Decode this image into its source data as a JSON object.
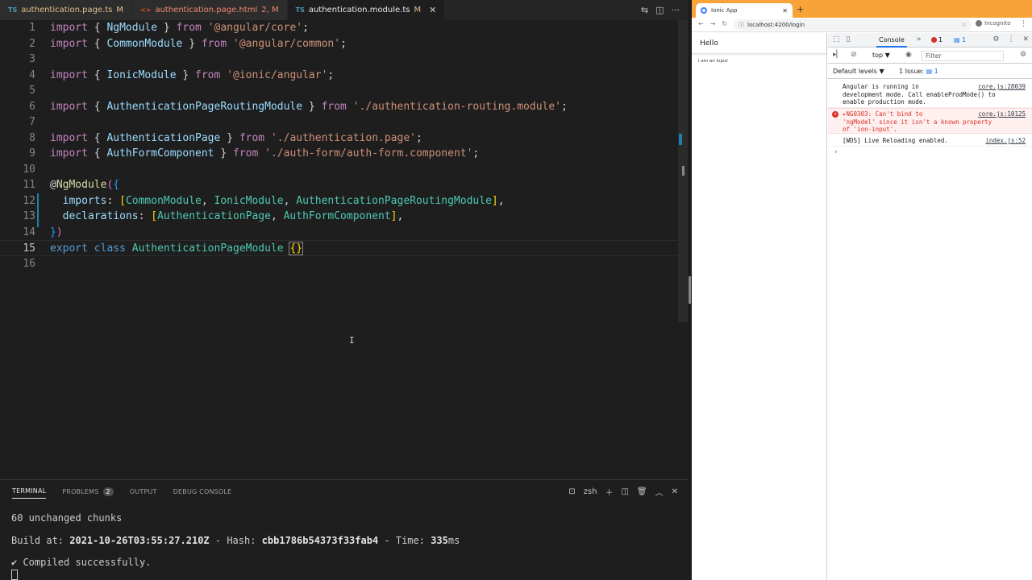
{
  "editor": {
    "tabs": [
      {
        "lang": "TS",
        "name": "authentication.page.ts",
        "status": "M"
      },
      {
        "lang": "",
        "name": "authentication.page.html",
        "status": "2, M"
      },
      {
        "lang": "TS",
        "name": "authentication.module.ts",
        "status": "M"
      }
    ],
    "lines": [
      {
        "n": "1"
      },
      {
        "n": "2"
      },
      {
        "n": "3"
      },
      {
        "n": "4"
      },
      {
        "n": "5"
      },
      {
        "n": "6"
      },
      {
        "n": "7"
      },
      {
        "n": "8"
      },
      {
        "n": "9"
      },
      {
        "n": "10"
      },
      {
        "n": "11"
      },
      {
        "n": "12"
      },
      {
        "n": "13"
      },
      {
        "n": "14"
      },
      {
        "n": "15"
      },
      {
        "n": "16"
      }
    ],
    "code": {
      "l1": {
        "kw": "import",
        "o": "{",
        "id": "NgModule",
        "c": "}",
        "from": "from",
        "str": "'@angular/core'",
        "end": ";"
      },
      "l2": {
        "kw": "import",
        "o": "{",
        "id": "CommonModule",
        "c": "}",
        "from": "from",
        "str": "'@angular/common'",
        "end": ";"
      },
      "l4": {
        "kw": "import",
        "o": "{",
        "id": "IonicModule",
        "c": "}",
        "from": "from",
        "str": "'@ionic/angular'",
        "end": ";"
      },
      "l6": {
        "kw": "import",
        "o": "{",
        "id": "AuthenticationPageRoutingModule",
        "c": "}",
        "from": "from",
        "str": "'./authentication-routing.module'",
        "end": ";"
      },
      "l8": {
        "kw": "import",
        "o": "{",
        "id": "AuthenticationPage",
        "c": "}",
        "from": "from",
        "str": "'./authentication.page'",
        "end": ";"
      },
      "l9": {
        "kw": "import",
        "o": "{",
        "id": "AuthFormComponent",
        "c": "}",
        "from": "from",
        "str": "'./auth-form/auth-form.component'",
        "end": ";"
      },
      "l11": {
        "at": "@",
        "fn": "NgModule",
        "o": "(",
        "b": "{"
      },
      "l12": {
        "prop": "imports",
        "colon": ":",
        "o": "[",
        "a": "CommonModule",
        "b": "IonicModule",
        "c": "AuthenticationPageRoutingModule",
        "cl": "]",
        "comma": ","
      },
      "l13": {
        "prop": "declarations",
        "colon": ":",
        "o": "[",
        "a": "AuthenticationPage",
        "b": "AuthFormComponent",
        "cl": "]",
        "comma": ","
      },
      "l14": {
        "b": "}",
        "p": ")"
      },
      "l15": {
        "kw": "export",
        "kw2": "class",
        "id": "AuthenticationPageModule",
        "b": "{}"
      }
    }
  },
  "panel": {
    "tabs": [
      "TERMINAL",
      "PROBLEMS",
      "OUTPUT",
      "DEBUG CONSOLE"
    ],
    "problems_count": "2",
    "shell": "zsh",
    "terminal": {
      "line1": "60 unchanged chunks",
      "build_label": "Build at: ",
      "build_time": "2021-10-26T03:55:27.210Z",
      "hash_label": " - Hash: ",
      "hash": "cbb1786b54373f33fab4",
      "time_label": " - Time: ",
      "time": "335",
      "time_unit": "ms",
      "compiled": "✔ Compiled successfully."
    }
  },
  "browser": {
    "tab_title": "Ionic App",
    "url": "localhost:4200/login",
    "incognito": "Incognito",
    "page": {
      "header": "Hello",
      "input_text": "I am an input"
    },
    "devtools": {
      "console_tab": "Console",
      "error_count": "1",
      "message_count": "1",
      "context": "top ▼",
      "filter_placeholder": "Filter",
      "levels": "Default levels ▼",
      "issues_label": "1 Issue:",
      "issues_count": "1",
      "messages": [
        {
          "text": "Angular is running in\ndevelopment mode. Call enableProdMode() to\nenable production mode.",
          "src": "core.js:28039"
        },
        {
          "text": "▸NG0303: Can't bind to\n'ngModel' since it isn't a known property\nof 'ion-input'.",
          "src": "core.js:10125"
        },
        {
          "text": "[WDS] Live Reloading enabled.",
          "src": "index.js:52"
        }
      ]
    }
  }
}
